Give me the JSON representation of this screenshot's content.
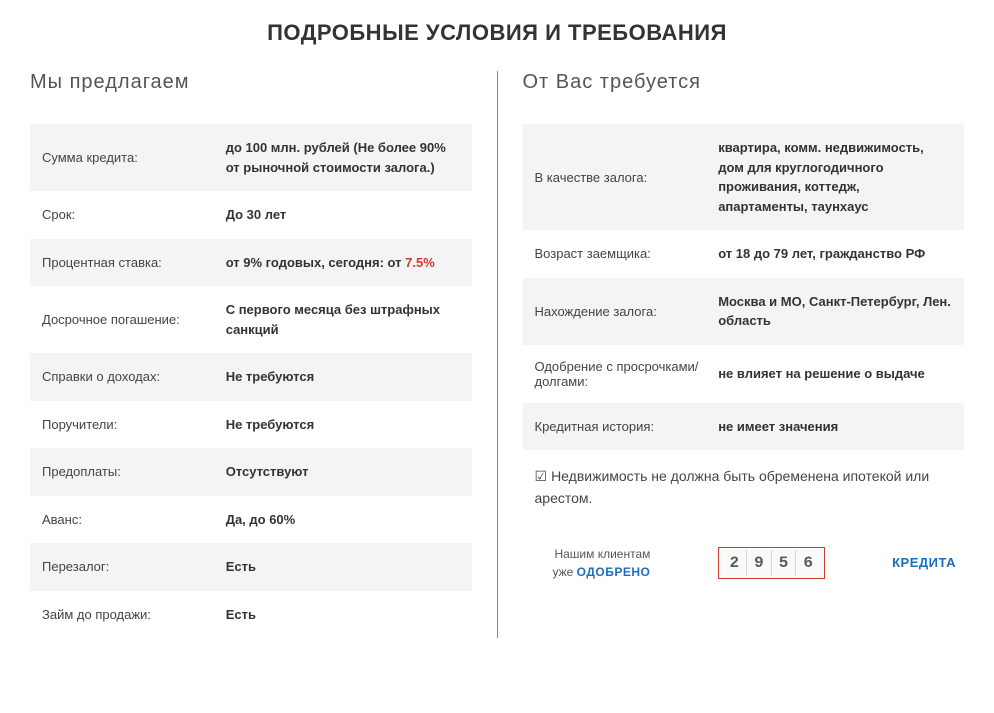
{
  "title": "ПОДРОБНЫЕ УСЛОВИЯ И ТРЕБОВАНИЯ",
  "left": {
    "heading": "Мы предлагаем",
    "rows": [
      {
        "label": "Сумма кредита:",
        "value": "до 100 млн. рублей (Не более 90% от рыночной стоимости залога.)"
      },
      {
        "label": "Срок:",
        "value": "До 30 лет"
      },
      {
        "label": "Процентная ставка:",
        "value_prefix": "от 9% годовых, сегодня: от ",
        "value_highlight": "7.5%"
      },
      {
        "label": "Досрочное погашение:",
        "value": "С первого месяца без штрафных санкций"
      },
      {
        "label": "Справки о доходах:",
        "value": "Не требуются"
      },
      {
        "label": "Поручители:",
        "value": "Не требуются"
      },
      {
        "label": "Предоплаты:",
        "value": "Отсутствуют"
      },
      {
        "label": "Аванс:",
        "value": "Да, до 60%"
      },
      {
        "label": "Перезалог:",
        "value": "Есть"
      },
      {
        "label": "Займ до продажи:",
        "value": "Есть"
      }
    ]
  },
  "right": {
    "heading": "От Вас требуется",
    "rows": [
      {
        "label": "В качестве залога:",
        "value": "квартира, комм. недвижимость, дом для круглогодичного проживания, коттедж, апартаменты, таунхаус"
      },
      {
        "label": "Возраст заемщика:",
        "value": "от 18 до 79 лет, гражданство РФ"
      },
      {
        "label": "Нахождение залога:",
        "value": "Москва и МО, Санкт-Петербург, Лен. область"
      },
      {
        "label": "Одобрение с просрочками/долгами:",
        "value": "не влияет на решение о выдаче"
      },
      {
        "label": "Кредитная история:",
        "value": "не имеет значения"
      }
    ],
    "note_check": "☑",
    "note": "Недвижимость не должна быть обременена ипотекой или арестом.",
    "counter_text1": "Нашим клиентам",
    "counter_text2": "уже ",
    "counter_approved": "ОДОБРЕНО",
    "counter_digits": [
      "2",
      "9",
      "5",
      "6"
    ],
    "counter_suffix": "КРЕДИТА"
  }
}
